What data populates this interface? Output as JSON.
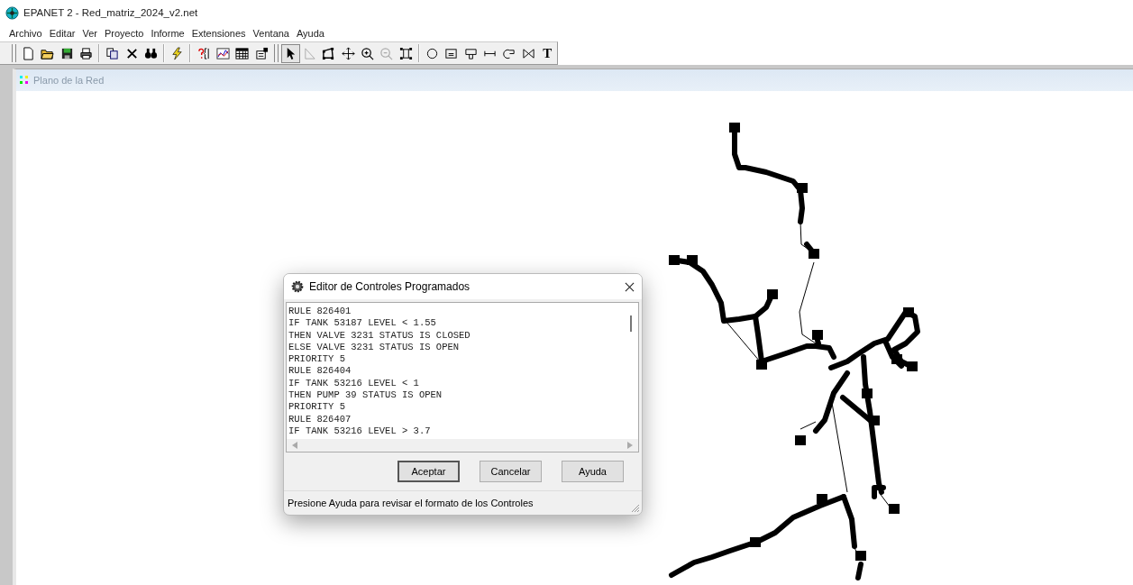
{
  "window": {
    "title": "EPANET 2 - Red_matriz_2024_v2.net"
  },
  "menu": [
    "Archivo",
    "Editar",
    "Ver",
    "Proyecto",
    "Informe",
    "Extensiones",
    "Ventana",
    "Ayuda"
  ],
  "map_tools": [
    {
      "selected": true,
      "disabled": false
    },
    {
      "selected": false,
      "disabled": true
    },
    {
      "selected": false,
      "disabled": false
    },
    {
      "selected": false,
      "disabled": false
    },
    {
      "selected": false,
      "disabled": false
    },
    {
      "selected": false,
      "disabled": true
    },
    {
      "selected": false,
      "disabled": false
    },
    {
      "selected": false,
      "disabled": false
    },
    {
      "selected": false,
      "disabled": false
    },
    {
      "selected": false,
      "disabled": false
    },
    {
      "selected": false,
      "disabled": false
    },
    {
      "selected": false,
      "disabled": false
    },
    {
      "selected": false,
      "disabled": false
    },
    {
      "selected": false,
      "disabled": false,
      "label": "T"
    }
  ],
  "map_window": {
    "title": "Plano de la Red"
  },
  "dialog": {
    "title": "Editor de Controles Programados",
    "lines": [
      "RULE 826401",
      "IF TANK 53187 LEVEL < 1.55",
      "THEN VALVE 3231 STATUS IS CLOSED",
      "ELSE VALVE 3231 STATUS IS OPEN",
      "PRIORITY 5",
      "RULE 826404",
      "IF TANK 53216 LEVEL < 1",
      "THEN PUMP 39 STATUS IS OPEN",
      "PRIORITY 5",
      "RULE 826407",
      "IF TANK 53216 LEVEL > 3.7"
    ],
    "buttons": [
      {
        "label": "Aceptar",
        "default": true
      },
      {
        "label": "Cancelar",
        "default": false
      },
      {
        "label": "Ayuda",
        "default": false
      }
    ],
    "status": "Presione Ayuda para revisar el formato de los Controles"
  }
}
